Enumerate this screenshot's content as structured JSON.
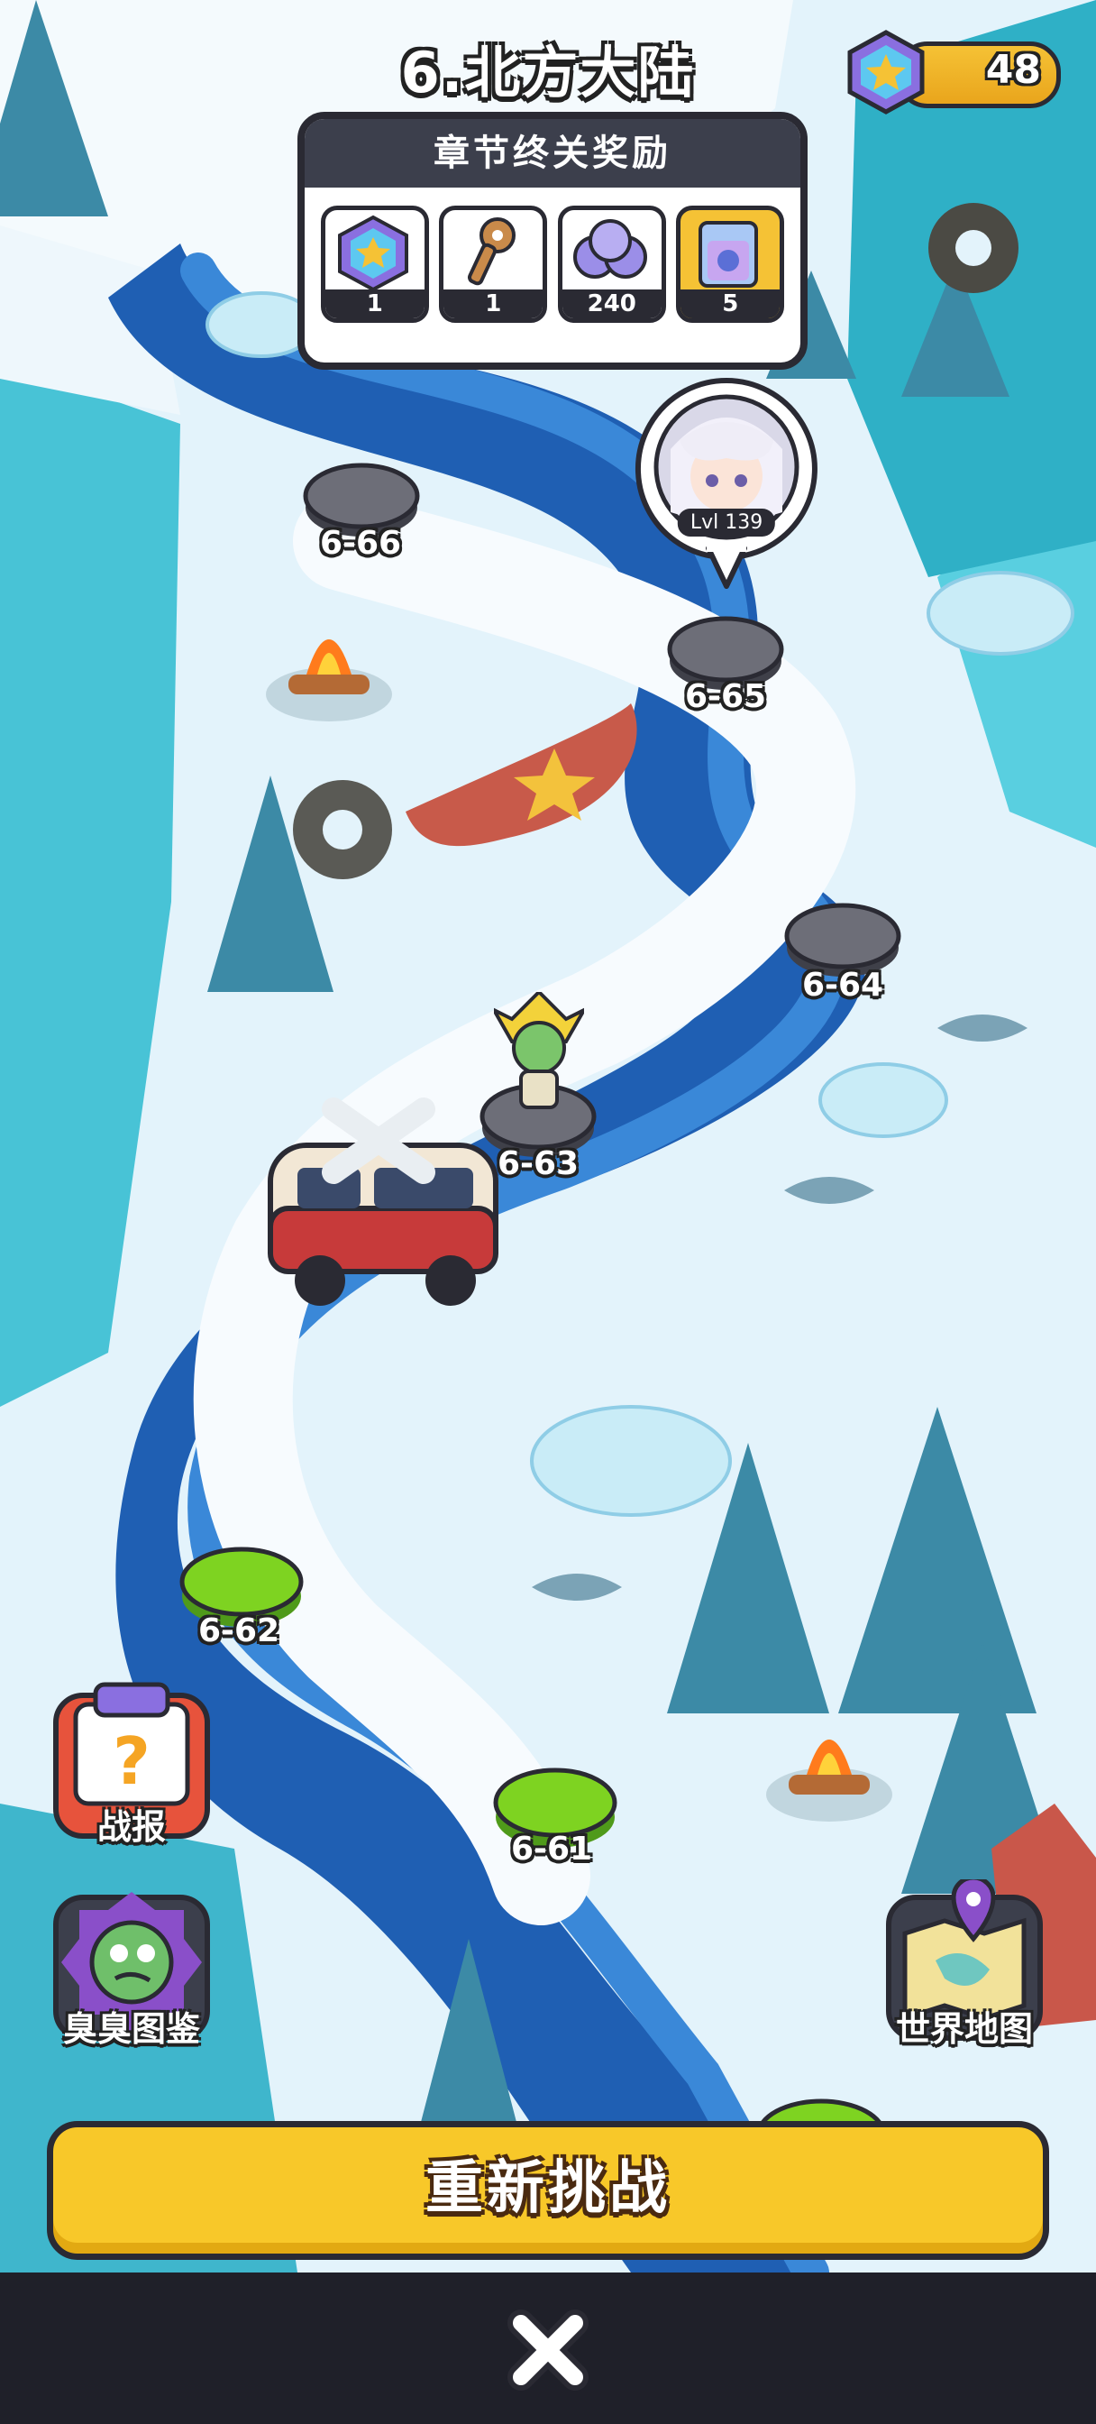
{
  "header": {
    "chapter_title": "6.北方大陆",
    "gem_count": "48"
  },
  "reward_panel": {
    "title": "章节终关奖励",
    "items": [
      {
        "icon": "star-gem-icon",
        "count": "1"
      },
      {
        "icon": "key-icon",
        "count": "1"
      },
      {
        "icon": "orbs-icon",
        "count": "240"
      },
      {
        "icon": "mystery-box-icon",
        "count": "5"
      }
    ]
  },
  "player": {
    "level": "Lvl 139"
  },
  "stages": [
    {
      "id": "6-66",
      "state": "locked"
    },
    {
      "id": "6-65",
      "state": "locked"
    },
    {
      "id": "6-64",
      "state": "locked"
    },
    {
      "id": "6-63",
      "state": "current"
    },
    {
      "id": "6-62",
      "state": "cleared"
    },
    {
      "id": "6-61",
      "state": "cleared"
    }
  ],
  "side_buttons": {
    "battle_report": "战报",
    "zombie_codex": "臭臭图鉴",
    "world_map": "世界地图"
  },
  "actions": {
    "retry": "重新挑战"
  },
  "colors": {
    "accent": "#f8c829",
    "cleared": "#7ed321",
    "locked": "#6d6e78",
    "ice_river": "#1f5fb3"
  }
}
